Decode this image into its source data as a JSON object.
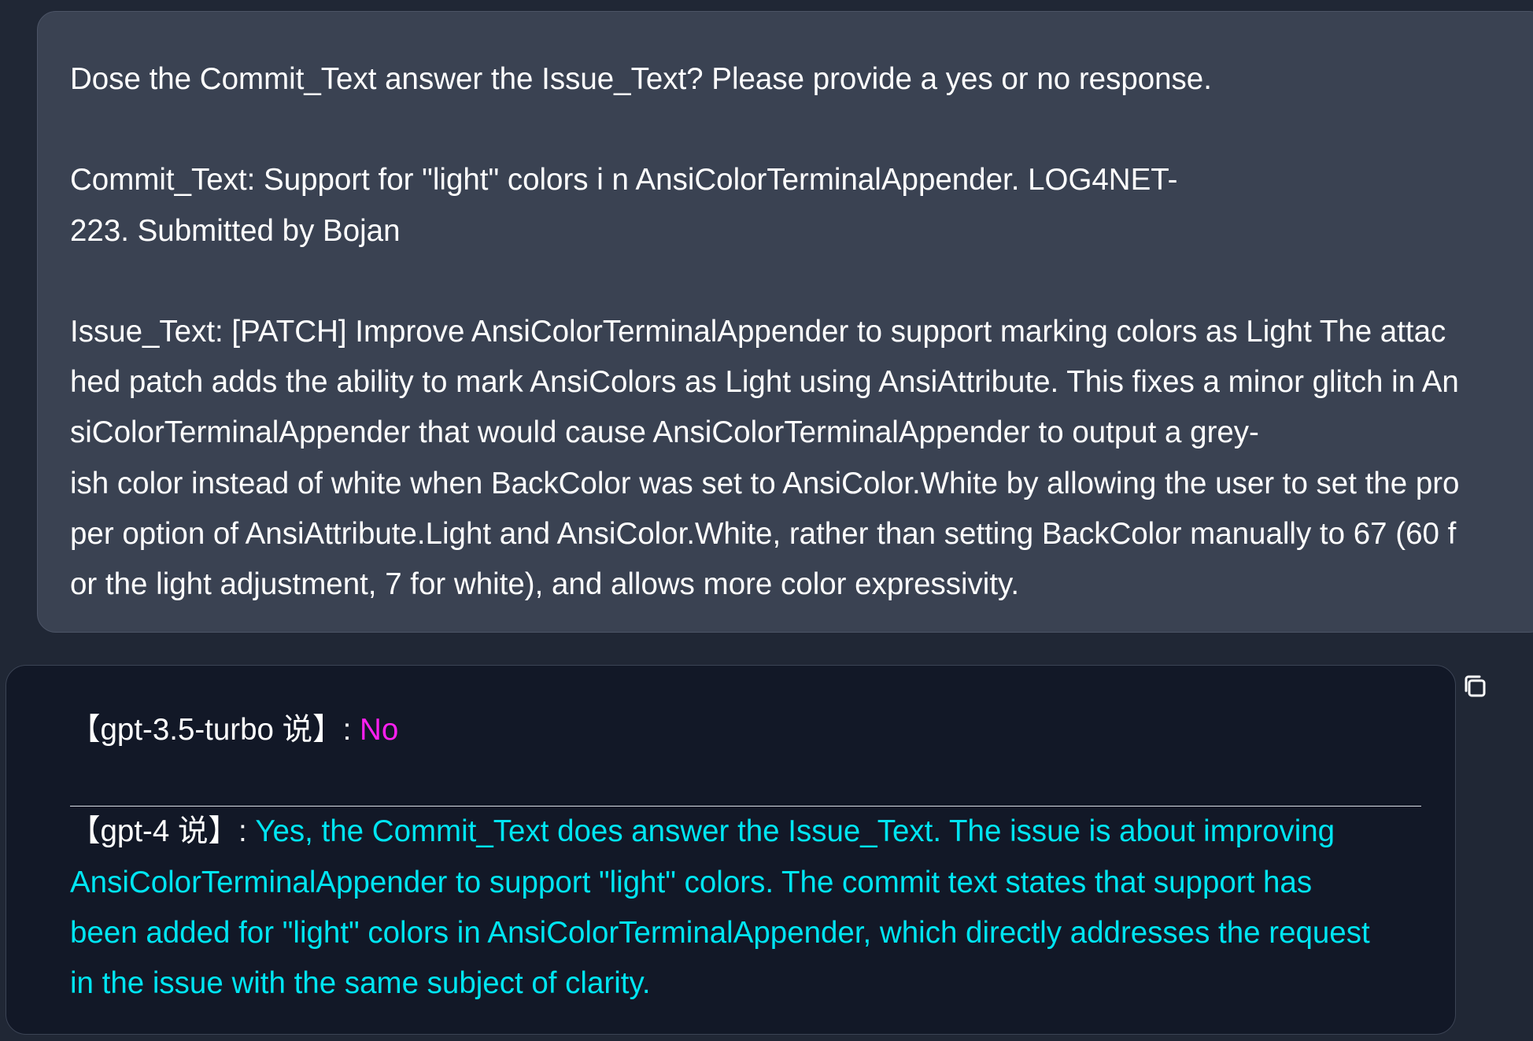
{
  "user_message": {
    "lines": [
      "Dose the Commit_Text answer the Issue_Text? Please provide a yes or no response.",
      "",
      "Commit_Text: Support for \"light\" colors i n AnsiColorTerminalAppender.  LOG4NET-",
      "223.  Submitted by Bojan",
      "",
      "Issue_Text: [PATCH] Improve AnsiColorTerminalAppender to support marking colors as Light The attac",
      "hed patch adds the ability to mark AnsiColors as Light using AnsiAttribute. This fixes a minor glitch in An",
      "siColorTerminalAppender that would cause AnsiColorTerminalAppender to output a grey-",
      "ish color instead of white when BackColor was set to AnsiColor.White by allowing the user to set the pro",
      "per option of AnsiAttribute.Light and AnsiColor.White, rather than setting BackColor manually to 67 (60 f",
      "or the light adjustment, 7 for white), and allows more color expressivity."
    ]
  },
  "responses": [
    {
      "prefix": "【gpt-3.5-turbo 说】: ",
      "answer_lines": [
        "No"
      ]
    },
    {
      "prefix": "【gpt-4 说】: ",
      "answer_lines": [
        "Yes, the Commit_Text does answer the Issue_Text. The issue is about improving",
        "AnsiColorTerminalAppender to support \"light\" colors. The commit text states that support has",
        "been added for \"light\" colors in AnsiColorTerminalAppender, which directly addresses the request",
        "in the issue with the same subject of clarity."
      ]
    }
  ],
  "colors": {
    "page_background": "#202735",
    "user_bubble": "#3a4252",
    "bot_bubble": "#121827",
    "gpt35_answer": "#ff1ff0",
    "gpt4_answer": "#00e5f2",
    "text": "#ffffff"
  },
  "icons": {
    "copy": "copy-icon"
  }
}
